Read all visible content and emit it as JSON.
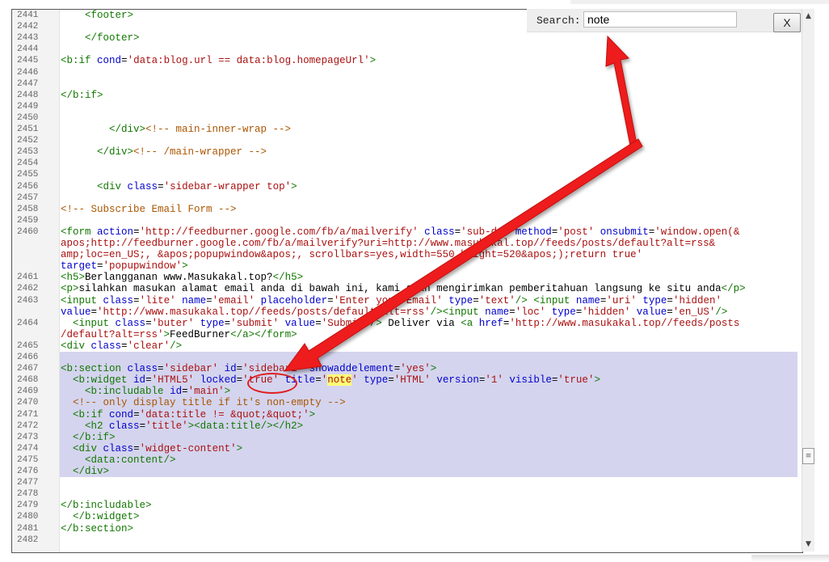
{
  "search": {
    "label": "Search:",
    "value": "note"
  },
  "close_label": "X",
  "scroll": {
    "up": "▲",
    "down": "▼",
    "thumb": "≡"
  },
  "lines": [
    {
      "n": "2441",
      "html": "    <span class=\"tag\">&lt;footer&gt;</span>"
    },
    {
      "n": "2442",
      "html": ""
    },
    {
      "n": "2443",
      "html": "    <span class=\"tag\">&lt;/footer&gt;</span>"
    },
    {
      "n": "2444",
      "html": ""
    },
    {
      "n": "2445",
      "html": "<span class=\"tag\">&lt;b:if</span> <span class=\"attr\">cond</span>=<span class=\"str\">'data:blog.url == data:blog.homepageUrl'</span><span class=\"tag\">&gt;</span>"
    },
    {
      "n": "2446",
      "html": ""
    },
    {
      "n": "2447",
      "html": ""
    },
    {
      "n": "2448",
      "html": "<span class=\"tag\">&lt;/b:if&gt;</span>"
    },
    {
      "n": "2449",
      "html": ""
    },
    {
      "n": "2450",
      "html": ""
    },
    {
      "n": "2451",
      "html": "        <span class=\"tag\">&lt;/div&gt;</span><span class=\"cmt\">&lt;!-- main-inner-wrap --&gt;</span>"
    },
    {
      "n": "2452",
      "html": ""
    },
    {
      "n": "2453",
      "html": "      <span class=\"tag\">&lt;/div&gt;</span><span class=\"cmt\">&lt;!-- /main-wrapper --&gt;</span>"
    },
    {
      "n": "2454",
      "html": ""
    },
    {
      "n": "2455",
      "html": ""
    },
    {
      "n": "2456",
      "html": "      <span class=\"tag\">&lt;div</span> <span class=\"attr\">class</span>=<span class=\"str\">'sidebar-wrapper top'</span><span class=\"tag\">&gt;</span>"
    },
    {
      "n": "2457",
      "html": ""
    },
    {
      "n": "2458",
      "html": "<span class=\"cmt\">&lt;!-- Subscribe Email Form --&gt;</span>"
    },
    {
      "n": "2459",
      "html": ""
    },
    {
      "n": "2460",
      "html": "<span class=\"tag\">&lt;form</span> <span class=\"attr\">action</span>=<span class=\"str\">'http://feedburner.google.com/fb/a/mailverify'</span> <span class=\"attr\">class</span>=<span class=\"str\">'sub-dd'</span> <span class=\"attr\">method</span>=<span class=\"str\">'post'</span> <span class=\"attr\">onsubmit</span>=<span class=\"str\">'window.open(&amp;</span>"
    },
    {
      "n": "",
      "html": "<span class=\"str\">apos;http://feedburner.google.com/fb/a/mailverify?uri=http://www.masukakal.top//feeds/posts/default?alt=rss&amp;</span>"
    },
    {
      "n": "",
      "html": "<span class=\"str\">amp;loc=en_US;, &amp;apos;popupwindow&amp;apos;, scrollbars=yes,width=550,height=520&amp;apos;);return true'</span>"
    },
    {
      "n": "",
      "html": "<span class=\"attr\">target</span>=<span class=\"str\">'popupwindow'</span><span class=\"tag\">&gt;</span>"
    },
    {
      "n": "2461",
      "html": "<span class=\"tag\">&lt;h5&gt;</span>Berlangganan www.Masukakal.top?<span class=\"tag\">&lt;/h5&gt;</span>"
    },
    {
      "n": "2462",
      "html": "<span class=\"tag\">&lt;p&gt;</span>silahkan masukan alamat email anda di bawah ini, kami akan mengirimkan pemberitahuan langsung ke situ anda<span class=\"tag\">&lt;/p&gt;</span>"
    },
    {
      "n": "2463",
      "html": "<span class=\"tag\">&lt;input</span> <span class=\"attr\">class</span>=<span class=\"str\">'lite'</span> <span class=\"attr\">name</span>=<span class=\"str\">'email'</span> <span class=\"attr\">placeholder</span>=<span class=\"str\">'Enter your Email'</span> <span class=\"attr\">type</span>=<span class=\"str\">'text'</span><span class=\"tag\">/&gt;</span> <span class=\"tag\">&lt;input</span> <span class=\"attr\">name</span>=<span class=\"str\">'uri'</span> <span class=\"attr\">type</span>=<span class=\"str\">'hidden'</span>"
    },
    {
      "n": "",
      "html": "<span class=\"attr\">value</span>=<span class=\"str\">'http://www.masukakal.top//feeds/posts/default?alt=rss'</span><span class=\"tag\">/&gt;</span><span class=\"tag\">&lt;input</span> <span class=\"attr\">name</span>=<span class=\"str\">'loc'</span> <span class=\"attr\">type</span>=<span class=\"str\">'hidden'</span> <span class=\"attr\">value</span>=<span class=\"str\">'en_US'</span><span class=\"tag\">/&gt;</span>"
    },
    {
      "n": "2464",
      "html": "  <span class=\"tag\">&lt;input</span> <span class=\"attr\">class</span>=<span class=\"str\">'buter'</span> <span class=\"attr\">type</span>=<span class=\"str\">'submit'</span> <span class=\"attr\">value</span>=<span class=\"str\">'Submit'</span><span class=\"tag\">/&gt;</span> Deliver via <span class=\"tag\">&lt;a</span> <span class=\"attr\">href</span>=<span class=\"str\">'http://www.masukakal.top//feeds/posts</span>"
    },
    {
      "n": "",
      "html": "<span class=\"str\">/default?alt=rss'</span><span class=\"tag\">&gt;</span>FeedBurner<span class=\"tag\">&lt;/a&gt;&lt;/form&gt;</span>"
    },
    {
      "n": "2465",
      "html": "<span class=\"tag\">&lt;div</span> <span class=\"attr\">class</span>=<span class=\"str\">'clear'</span><span class=\"tag\">/&gt;</span>"
    },
    {
      "n": "2466",
      "html": ""
    },
    {
      "n": "2467",
      "html": "<span class=\"tag\">&lt;b:section</span> <span class=\"attr\">class</span>=<span class=\"str\">'sidebar'</span> <span class=\"attr\">id</span>=<span class=\"str\">'sidebar1'</span> <span class=\"attr\">showaddelement</span>=<span class=\"str\">'yes'</span><span class=\"tag\">&gt;</span>"
    },
    {
      "n": "2468",
      "html": "  <span class=\"tag\">&lt;b:widget</span> <span class=\"attr\">id</span>=<span class=\"str\">'HTML5'</span> <span class=\"attr\">locked</span>=<span class=\"str\">'true'</span> <span class=\"attr\">title</span>=<span class=\"str\">'<span class=\"hl\">note</span>'</span> <span class=\"attr\">type</span>=<span class=\"str\">'HTML'</span> <span class=\"attr\">version</span>=<span class=\"str\">'1'</span> <span class=\"attr\">visible</span>=<span class=\"str\">'true'</span><span class=\"tag\">&gt;</span>"
    },
    {
      "n": "2469",
      "html": "    <span class=\"tag\">&lt;b:includable</span> <span class=\"attr\">id</span>=<span class=\"str\">'main'</span><span class=\"tag\">&gt;</span>"
    },
    {
      "n": "2470",
      "html": "  <span class=\"cmt\">&lt;!-- only display title if it's non-empty --&gt;</span>"
    },
    {
      "n": "2471",
      "html": "  <span class=\"tag\">&lt;b:if</span> <span class=\"attr\">cond</span>=<span class=\"str\">'data:title != &amp;quot;&amp;quot;'</span><span class=\"tag\">&gt;</span>"
    },
    {
      "n": "2472",
      "html": "    <span class=\"tag\">&lt;h2</span> <span class=\"attr\">class</span>=<span class=\"str\">'title'</span><span class=\"tag\">&gt;</span><span class=\"tag\">&lt;data:title/&gt;</span><span class=\"tag\">&lt;/h2&gt;</span>"
    },
    {
      "n": "2473",
      "html": "  <span class=\"tag\">&lt;/b:if&gt;</span>"
    },
    {
      "n": "2474",
      "html": "  <span class=\"tag\">&lt;div</span> <span class=\"attr\">class</span>=<span class=\"str\">'widget-content'</span><span class=\"tag\">&gt;</span>"
    },
    {
      "n": "2475",
      "html": "    <span class=\"tag\">&lt;data:content/&gt;</span>"
    },
    {
      "n": "2476",
      "html": "  <span class=\"tag\">&lt;/div&gt;</span>"
    },
    {
      "n": "2477",
      "html": ""
    },
    {
      "n": "2478",
      "html": ""
    },
    {
      "n": "2479",
      "html": "<span class=\"tag\">&lt;/b:includable&gt;</span>"
    },
    {
      "n": "2480",
      "html": "  <span class=\"tag\">&lt;/b:widget&gt;</span>"
    },
    {
      "n": "2481",
      "html": "<span class=\"tag\">&lt;/b:section&gt;</span>"
    },
    {
      "n": "2482",
      "html": ""
    }
  ]
}
